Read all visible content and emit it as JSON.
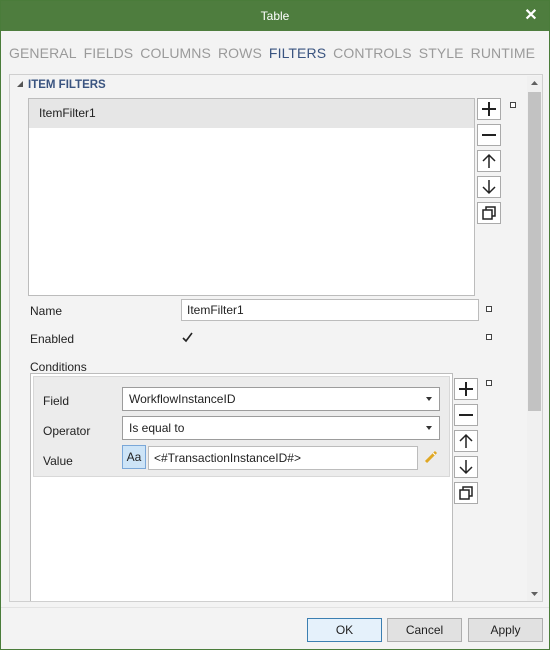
{
  "window": {
    "title": "Table",
    "close_glyph": "✕"
  },
  "tabs": [
    {
      "label": "GENERAL",
      "active": false
    },
    {
      "label": "FIELDS",
      "active": false
    },
    {
      "label": "COLUMNS",
      "active": false
    },
    {
      "label": "ROWS",
      "active": false
    },
    {
      "label": "FILTERS",
      "active": true
    },
    {
      "label": "CONTROLS",
      "active": false
    },
    {
      "label": "STYLE",
      "active": false
    },
    {
      "label": "RUNTIME",
      "active": false
    }
  ],
  "item_filters": {
    "header": "ITEM FILTERS",
    "list": [
      "ItemFilter1"
    ],
    "buttons": [
      "add-icon",
      "remove-icon",
      "move-up-icon",
      "move-down-icon",
      "copy-icon"
    ]
  },
  "properties": {
    "name_label": "Name",
    "name_value": "ItemFilter1",
    "enabled_label": "Enabled",
    "enabled_checked": true,
    "conditions_label": "Conditions"
  },
  "condition": {
    "field_label": "Field",
    "field_value": "WorkflowInstanceID",
    "operator_label": "Operator",
    "operator_value": "Is equal to",
    "value_label": "Value",
    "value_type_button": "Aa",
    "value_text": "<#TransactionInstanceID#>"
  },
  "footer": {
    "ok": "OK",
    "cancel": "Cancel",
    "apply": "Apply"
  },
  "colors": {
    "titlebar": "#4e7d3e",
    "accent": "#3a5480"
  }
}
